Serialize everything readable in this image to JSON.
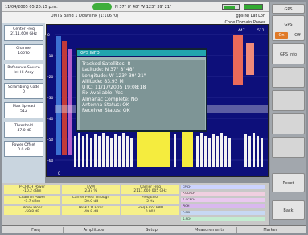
{
  "status_bar": {
    "datetime": "11/04/2005 05:20:15 p.m.",
    "coordinates": "N 37° 8' 48\"  W 123° 39' 21\""
  },
  "header": {
    "mode": "UMTS Band 1 Downlink (1:10670)",
    "gps": "gps(N) Lat Lon",
    "view": "Code Domain Power"
  },
  "left_panel": [
    {
      "label": "Center Freq",
      "value": "2111.600 GHz"
    },
    {
      "label": "Channel",
      "value": "10670"
    },
    {
      "label": "Reference Source",
      "value": "Int Hi Accy"
    },
    {
      "label": "Scrambling Code",
      "value": "0"
    },
    {
      "label": "Max Spread",
      "value": "512"
    },
    {
      "label": "Threshold",
      "value": "-47.0 dB"
    },
    {
      "label": "Power Offset",
      "value": "0.0 dB"
    }
  ],
  "plot": {
    "y_ticks": [
      "0",
      "-10",
      "-20",
      "-30",
      "-40",
      "-50",
      "-60"
    ],
    "top_ticks": [
      "447",
      "511"
    ],
    "x_tick": "0"
  },
  "popup": {
    "title": "GPS INFO",
    "lines": [
      "Tracked Satellites: 8",
      "Latitude: N 37° 8' 48\"",
      "Longitude:  W 123° 39' 21\"",
      "Altitude: 83.93 M",
      "UTC: 11/17/2005 19:08:18",
      "Fix Available: Yes",
      "Almanac Complete: No",
      "Antenna Status: OK",
      "Receiver Status: OK"
    ]
  },
  "softkeys": {
    "gps_title": "GPS",
    "gps_label": "GPS",
    "on": "On",
    "off": "Off",
    "gps_info": "GPS Info",
    "reset": "Reset",
    "back": "Back"
  },
  "bottom": {
    "cells": [
      {
        "label": "P-CPICH Power",
        "value": "-10.2 dBm"
      },
      {
        "label": "EVM",
        "value": "2.37 %"
      },
      {
        "label": "Carrier Freq",
        "value": "2111.600 005 GHz"
      },
      {
        "label": "Channel Power",
        "value": "-3.7 dBm"
      },
      {
        "label": "Carrier Feed Through",
        "value": "-50.0 dB"
      },
      {
        "label": "Freq Error",
        "value": "5 Hz"
      },
      {
        "label": "Noise Floor",
        "value": "-59.8 dB"
      },
      {
        "label": "Peak CD Error",
        "value": "-49.8 dB"
      },
      {
        "label": "Freq Error PPM",
        "value": "0.002"
      }
    ],
    "legend": [
      "CPICH",
      "P-CCPCH",
      "S-CCPCH",
      "PICH",
      "P-SCH",
      "S-SCH"
    ]
  },
  "tabs": [
    "Freq",
    "Amplitude",
    "Setup",
    "Measurements",
    "Marker"
  ],
  "colors": {
    "plot_bg": "#0d0f7a",
    "highlight_yellow": "#f5ec3e",
    "bar_white": "#f2f2f2",
    "popup_title": "#21a5ae",
    "accent_orange": "#e07a28"
  }
}
